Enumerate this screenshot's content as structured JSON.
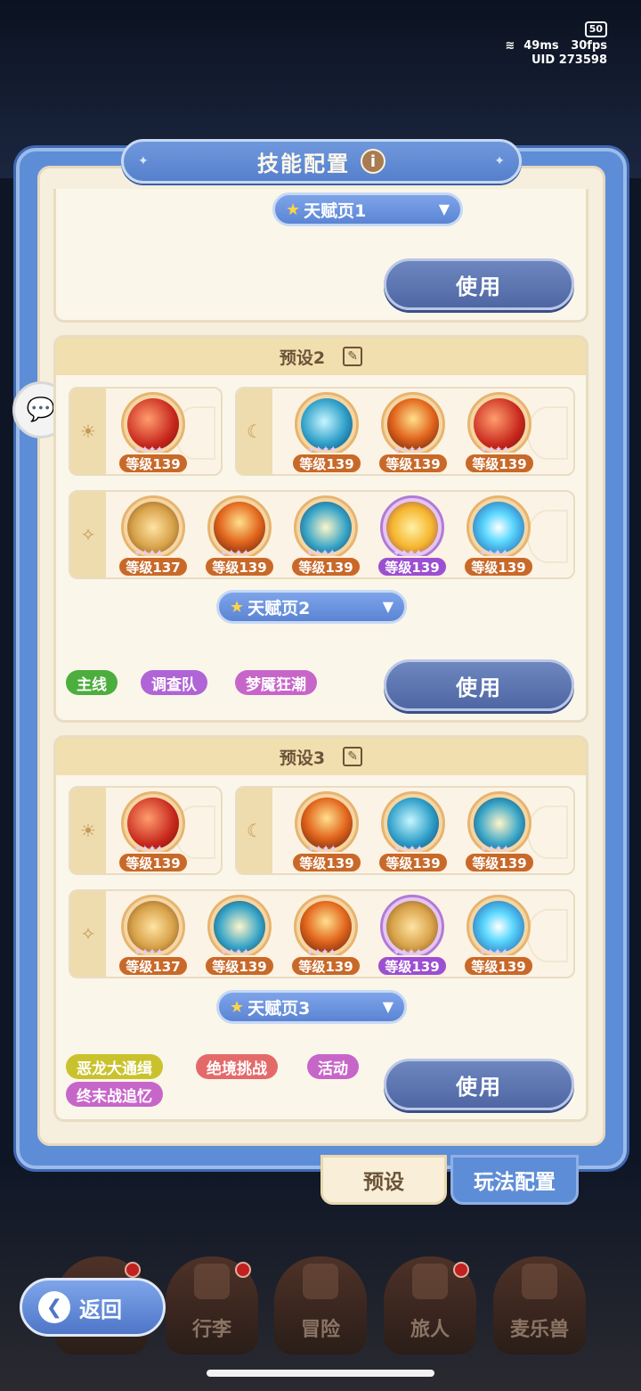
{
  "status": {
    "battery": "50",
    "ping": "49ms",
    "fps": "30fps",
    "uid_label": "UID",
    "uid": "273598"
  },
  "title": "技能配置",
  "info_icon": "i",
  "chat_icon": "💬",
  "preset1": {
    "talent": "天赋页1",
    "use_label": "使用"
  },
  "preset2": {
    "name": "预设2",
    "sun_row": [
      {
        "level": "等级139",
        "art": "red"
      }
    ],
    "moon_row": [
      {
        "level": "等级139",
        "art": "blue"
      },
      {
        "level": "等级139",
        "art": "fire"
      },
      {
        "level": "等级139",
        "art": "red"
      }
    ],
    "star_row": [
      {
        "level": "等级137",
        "art": "gold"
      },
      {
        "level": "等级139",
        "art": "fire"
      },
      {
        "level": "等级139",
        "art": "teal"
      },
      {
        "level": "等级139",
        "art": "yellow",
        "purple": true
      },
      {
        "level": "等级139",
        "art": "sun"
      }
    ],
    "talent": "天赋页2",
    "use_label": "使用",
    "tags": [
      {
        "text": "主线",
        "color": "#4cae3d"
      },
      {
        "text": "调查队",
        "color": "#b064d6"
      },
      {
        "text": "梦魇狂潮",
        "color": "#c766c9"
      }
    ]
  },
  "preset3": {
    "name": "预设3",
    "sun_row": [
      {
        "level": "等级139",
        "art": "red"
      }
    ],
    "moon_row": [
      {
        "level": "等级139",
        "art": "fire"
      },
      {
        "level": "等级139",
        "art": "blue"
      },
      {
        "level": "等级139",
        "art": "teal"
      }
    ],
    "star_row": [
      {
        "level": "等级137",
        "art": "gold"
      },
      {
        "level": "等级139",
        "art": "teal"
      },
      {
        "level": "等级139",
        "art": "fire"
      },
      {
        "level": "等级139",
        "art": "gold",
        "purple": true
      },
      {
        "level": "等级139",
        "art": "sun"
      }
    ],
    "talent": "天赋页3",
    "use_label": "使用",
    "tags": [
      {
        "text": "恶龙大通缉",
        "color": "#c9c22c"
      },
      {
        "text": "绝境挑战",
        "color": "#e46a6a"
      },
      {
        "text": "活动",
        "color": "#c766c9"
      },
      {
        "text": "终末战追忆",
        "color": "#c766c9"
      }
    ]
  },
  "tabs": {
    "preset": "预设",
    "gameplay": "玩法配置"
  },
  "nav": {
    "back": "返回",
    "items": [
      "行李",
      "冒险",
      "旅人",
      "麦乐兽"
    ]
  }
}
